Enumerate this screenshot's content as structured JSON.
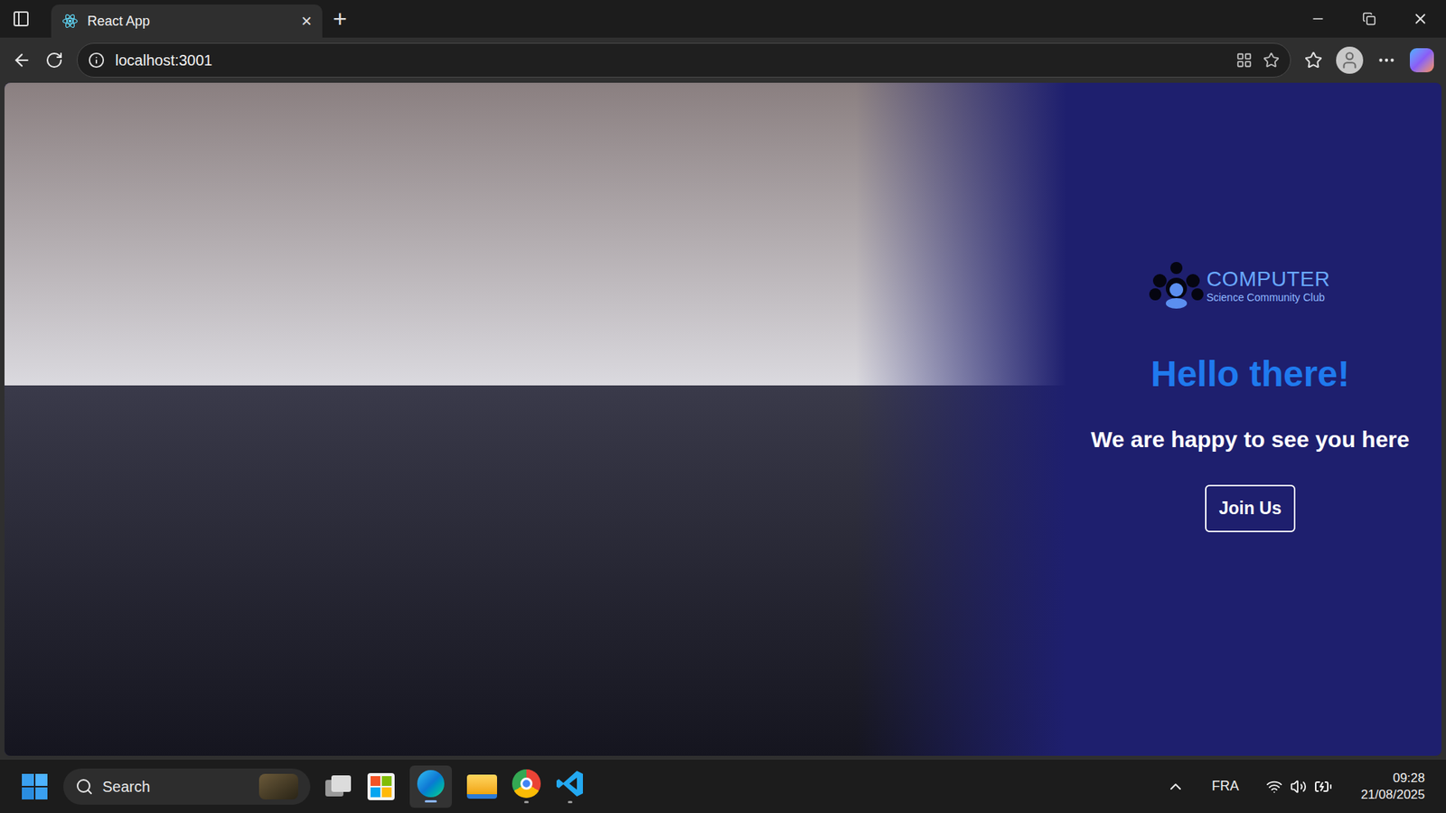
{
  "browser": {
    "tab": {
      "title": "React App",
      "close": "×",
      "selected": true
    },
    "new_tab": "+",
    "address": "localhost:3001"
  },
  "hero": {
    "logo": {
      "title": "COMPUTER",
      "subtitle": "Science Community Club"
    },
    "heading": "Hello there!",
    "subheading": "We are happy to see you here",
    "button": "Join Us"
  },
  "taskbar": {
    "search": "Search",
    "language": "FRA",
    "time": "09:28",
    "date": "21/08/2025"
  }
}
